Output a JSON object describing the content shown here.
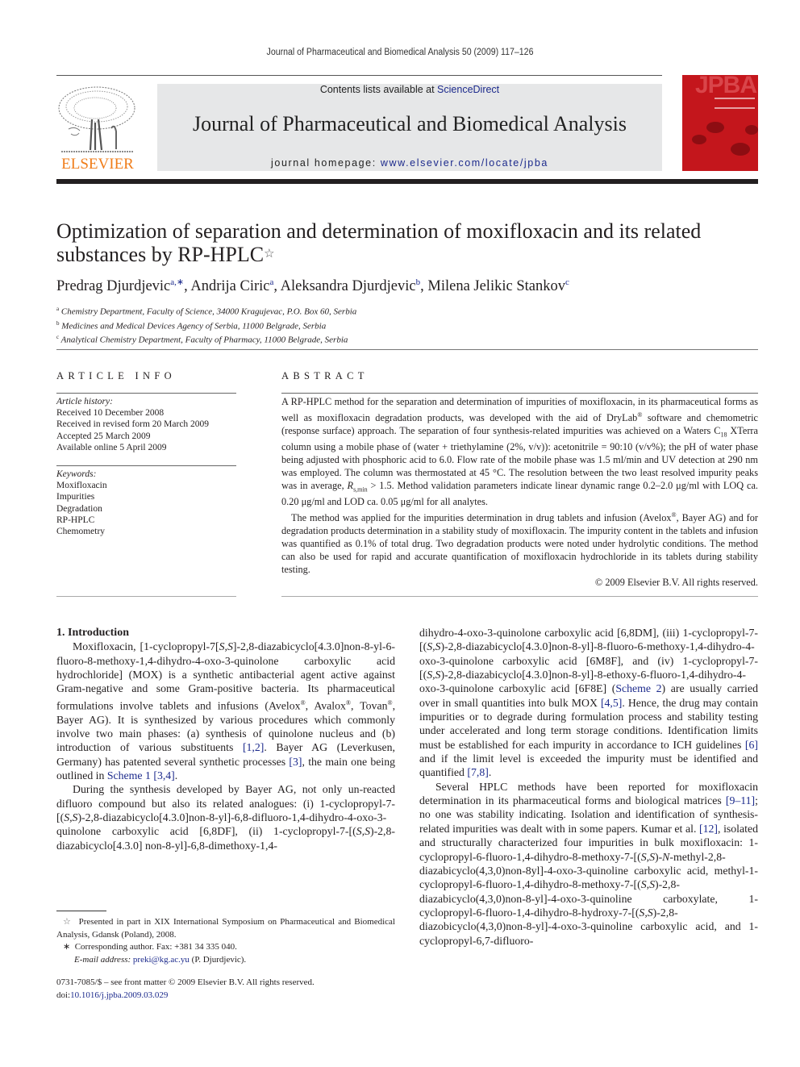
{
  "running_head": "Journal of Pharmaceutical and Biomedical Analysis 50 (2009) 117–126",
  "header": {
    "publisher_logo": "elsevier-tree-logo",
    "publisher_name": "ELSEVIER",
    "contents_prefix": "Contents lists available at ",
    "contents_link": "ScienceDirect",
    "journal_title": "Journal of Pharmaceutical and Biomedical Analysis",
    "homepage_prefix": "journal homepage: ",
    "homepage_link": "www.elsevier.com/locate/jpba",
    "cover_label": "JPBA",
    "colors": {
      "publisher_orange": "#f07d1a",
      "banner_gray": "#e6e7e8",
      "cover_red": "#c4161c",
      "link_blue": "#1c2a8c"
    }
  },
  "article": {
    "title_line1": "Optimization of separation and determination of moxifloxacin and its related",
    "title_line2": "substances by RP-HPLC",
    "title_note": "☆",
    "authors": [
      {
        "name": "Predrag Djurdjevic",
        "sup": "a,∗",
        "sep": ", "
      },
      {
        "name": "Andrija Ciric",
        "sup": "a",
        "sep": ", "
      },
      {
        "name": "Aleksandra Djurdjevic",
        "sup": "b",
        "sep": ", "
      },
      {
        "name": "Milena Jelikic Stankov",
        "sup": "c",
        "sep": ""
      }
    ],
    "affiliations": [
      {
        "mark": "a",
        "text": "Chemistry Department, Faculty of Science, 34000 Kragujevac, P.O. Box 60, Serbia"
      },
      {
        "mark": "b",
        "text": "Medicines and Medical Devices Agency of Serbia, 11000 Belgrade, Serbia"
      },
      {
        "mark": "c",
        "text": "Analytical Chemistry Department, Faculty of Pharmacy, 11000 Belgrade, Serbia"
      }
    ]
  },
  "article_info": {
    "heading": "ARTICLE INFO",
    "history_label": "Article history:",
    "history": [
      "Received 10 December 2008",
      "Received in revised form 20 March 2009",
      "Accepted 25 March 2009",
      "Available online 5 April 2009"
    ],
    "keywords_label": "Keywords:",
    "keywords": [
      "Moxifloxacin",
      "Impurities",
      "Degradation",
      "RP-HPLC",
      "Chemometry"
    ]
  },
  "abstract": {
    "heading": "ABSTRACT",
    "p1_a": "A RP-HPLC method for the separation and determination of impurities of moxifloxacin, in its pharmaceutical forms as well as moxifloxacin degradation products, was developed with the aid of DryLab",
    "p1_b": " software and chemometric (response surface) approach. The separation of four synthesis-related impurities was achieved on a Waters C",
    "p1_c": " XTerra column using a mobile phase of (water + triethylamine (2%, v/v)): acetonitrile = 90:10 (v/v%); the pH of water phase being adjusted with phosphoric acid to 6.0. Flow rate of the mobile phase was 1.5 ml/min and UV detection at 290 nm was employed. The column was thermostated at 45 °C. The resolution between the two least resolved impurity peaks was in average, ",
    "rs": "R",
    "rs_sub": "s,min",
    "p1_d": " > 1.5. Method validation parameters indicate linear dynamic range 0.2–2.0 μg/ml with LOQ ca. 0.20 μg/ml and LOD ca. 0.05 μg/ml for all analytes.",
    "c18_sub": "18",
    "reg": "®",
    "p2_a": "The method was applied for the impurities determination in drug tablets and infusion (Avelox",
    "p2_b": ", Bayer AG) and for degradation products determination in a stability study of moxifloxacin. The impurity content in the tablets and infusion was quantified as 0.1% of total drug. Two degradation products were noted under hydrolytic conditions. The method can also be used for rapid and accurate quantification of moxifloxacin hydrochloride in its tablets during stability testing.",
    "copyright": "© 2009 Elsevier B.V. All rights reserved."
  },
  "body": {
    "section_heading": "1.  Introduction",
    "left": {
      "p1_a": "Moxifloxacin, [1-cyclopropyl-7[",
      "ss": "S,S",
      "p1_b": "]-2,8-diazabicyclo[4.3.0]non-8-yl-6-fluoro-8-methoxy-1,4-dihydro-4-oxo-3-quinolone carboxylic acid hydrochloride] (MOX) is a synthetic antibacterial agent active against Gram-negative and some Gram-positive bacteria. Its pharmaceutical formulations involve tablets and infusions (Avelox",
      "reg": "®",
      "p1_c": ", Avalox",
      "p1_d": ", Tovan",
      "p1_e": ", Bayer AG). It is synthesized by various procedures which commonly involve two main phases: (a) synthesis of quinolone nucleus and (b) introduction of various substituents ",
      "ref_1_2": "[1,2]",
      "p1_f": ". Bayer AG (Leverkusen, Germany) has patented several synthetic processes ",
      "ref_3": "[3]",
      "p1_g": ", the main one being outlined in ",
      "ref_scheme1": "Scheme 1",
      "ref_3_4": "[3,4]",
      "p1_h": ".",
      "p2_a": "During the synthesis developed by Bayer AG, not only un-reacted difluoro compound but also its related analogues: (i) 1-cyclopropyl-7-[(",
      "ss2": "S,S",
      "p2_b": ")-2,8-diazabicyclo[4.3.0]non-8-yl]-6,8-difluoro-1,4-dihydro-4-oxo-3-quinolone carboxylic acid [6,8DF], (ii) 1-cyclopropyl-7-[(",
      "p2_c": ")-2,8-diazabicyclo[4.3.0] non-8-yl]-6,8-dimethoxy-1,4-"
    },
    "right": {
      "p1_a": "dihydro-4-oxo-3-quinolone carboxylic acid [6,8DM], (iii) 1-cyclopropyl-7-[(",
      "ss": "S,S",
      "p1_b": ")-2,8-diazabicyclo[4.3.0]non-8-yl]-8-fluoro-6-methoxy-1,4-dihydro-4-oxo-3-quinolone carboxylic acid [6M8F], and (iv) 1-cyclopropyl-7-[(",
      "p1_c": ")-2,8-diazabicyclo[4.3.0]non-8-yl]-8-ethoxy-6-fluoro-1,4-dihydro-4-oxo-3-quinolone carboxylic acid [6F8E] (",
      "ref_scheme2": "Scheme 2",
      "p1_d": ") are usually carried over in small quantities into bulk MOX ",
      "ref_4_5": "[4,5]",
      "p1_e": ". Hence, the drug may contain impurities or to degrade during formulation process and stability testing under accelerated and long term storage conditions. Identification limits must be established for each impurity in accordance to ICH guidelines ",
      "ref_6": "[6]",
      "p1_f": " and if the limit level is exceeded the impurity must be identified and quantified ",
      "ref_7_8": "[7,8]",
      "p1_g": ".",
      "p2_a": "Several HPLC methods have been reported for moxifloxacin determination in its pharmaceutical forms and biological matrices ",
      "ref_9_11": "[9–11]",
      "p2_b": "; no one was stability indicating. Isolation and identification of synthesis-related impurities was dealt with in some papers. Kumar et al. ",
      "ref_12": "[12]",
      "p2_c": ", isolated and structurally characterized four impurities in bulk moxifloxacin: 1-cyclopropyl-6-fluoro-1,4-dihydro-8-methoxy-7-[(",
      "n": "N",
      "p2_d": "-methyl-2,8-diazabicyclo(4,3,0)non-8yl]-4-oxo-3-quinoline carboxylic acid, methyl-1-cyclopropyl-6-fluoro-1,4-dihydro-8-methoxy-7-[(",
      "p2_e": ")-2,8-diazabicyclo(4,3,0)non-8-yl]-4-oxo-3-quinoline carboxylate, 1-cyclopropyl-6-fluoro-1,4-dihydro-8-hydroxy-7-[(",
      "p2_f": ")-2,8-diazobicyclo(4,3,0)non-8-yl]-4-oxo-3-quinoline carboxylic acid, and 1-cyclopropyl-6,7-difluoro-"
    }
  },
  "footnotes": {
    "star_mark": "☆",
    "star_text": "Presented in part in XIX International Symposium on Pharmaceutical and Biomedical Analysis, Gdansk (Poland), 2008.",
    "corr_mark": "∗",
    "corr_text": "Corresponding author. Fax: +381 34 335 040.",
    "email_label": "E-mail address: ",
    "email": "preki@kg.ac.yu",
    "email_suffix": " (P. Djurdjevic)."
  },
  "front_matter": {
    "issn_line": "0731-7085/$ – see front matter © 2009 Elsevier B.V. All rights reserved.",
    "doi_prefix": "doi:",
    "doi": "10.1016/j.jpba.2009.03.029"
  }
}
